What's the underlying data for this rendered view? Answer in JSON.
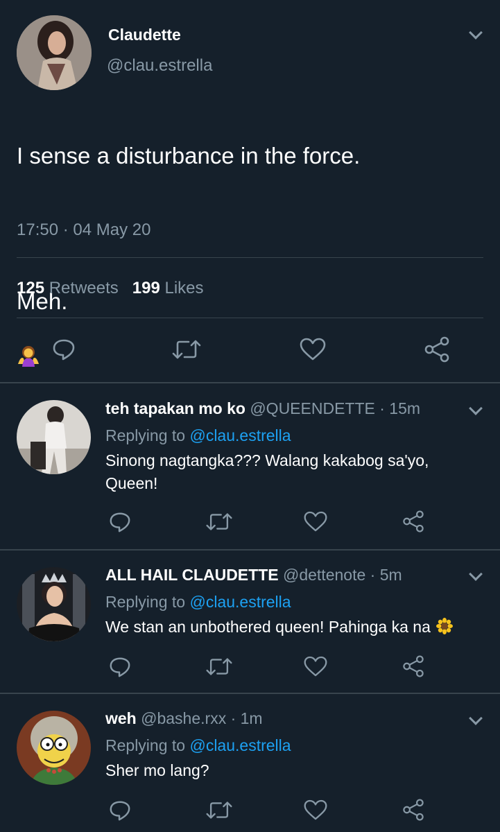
{
  "main_tweet": {
    "name": "Claudette",
    "handle": "@clau.estrella",
    "text_line1": "I sense a disturbance in the force.",
    "text_line2": "Meh.",
    "timestamp": "17:50 · 04 May 20",
    "retweets_count": "125",
    "retweets_label": "Retweets",
    "likes_count": "199",
    "likes_label": "Likes"
  },
  "replies": [
    {
      "name": "teh tapakan mo ko",
      "meta": "@QUEENDETTE · 15m",
      "replying_prefix": "Replying to",
      "replying_handle": "@clau.estrella",
      "text": "Sinong nagtangka??? Walang kakabog sa'yo, Queen!"
    },
    {
      "name": "ALL HAIL CLAUDETTE",
      "meta": "@dettenote · 5m",
      "replying_prefix": "Replying to",
      "replying_handle": "@clau.estrella",
      "text": "We stan an unbothered queen! Pahinga ka na"
    },
    {
      "name": "weh",
      "meta": "@bashe.rxx · 1m",
      "replying_prefix": "Replying to",
      "replying_handle": "@clau.estrella",
      "text": "Sher mo lang?"
    }
  ],
  "icons": {
    "reply": "reply-icon",
    "retweet": "retweet-icon",
    "like": "heart-icon",
    "share": "share-icon",
    "more": "chevron-down-icon"
  },
  "colors": {
    "background": "#15202b",
    "muted": "#8899a6",
    "link": "#1da1f2",
    "divider": "#38444d"
  }
}
